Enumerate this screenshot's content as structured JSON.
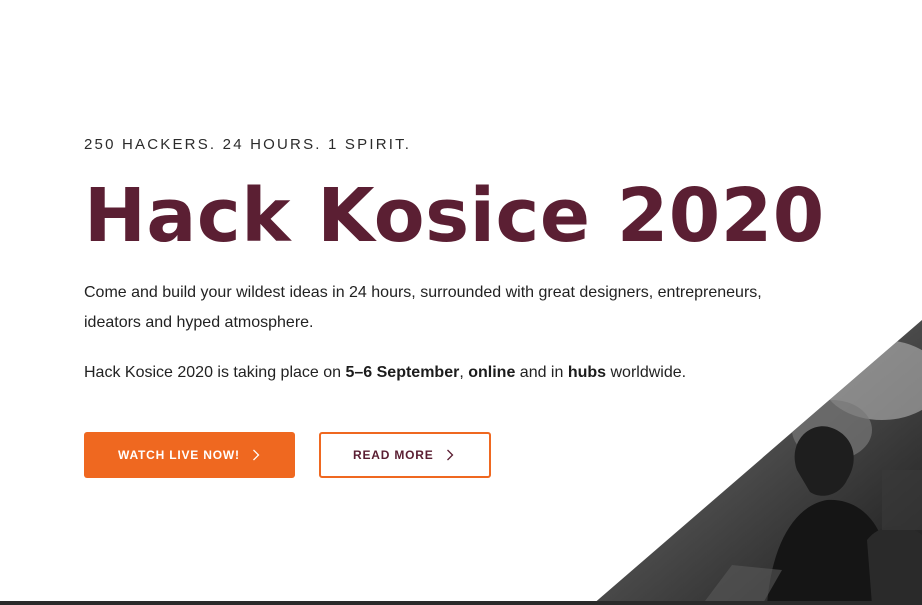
{
  "hero": {
    "tagline": "250 HACKERS. 24 HOURS. 1 SPIRIT.",
    "title": "Hack Kosice 2020",
    "intro": "Come and build your wildest ideas in 24 hours, surrounded with great designers, entrepreneurs, ideators and hyped atmosphere.",
    "dates": {
      "prefix": "Hack Kosice 2020 is taking place on ",
      "date": "5–6 September",
      "comma": ",",
      "online": "online",
      "middle": " and in ",
      "hubs": "hubs",
      "suffix": " worldwide."
    }
  },
  "buttons": {
    "watch_label": "WATCH LIVE NOW!",
    "read_label": "READ MORE"
  },
  "icons": {
    "watch_chevron": "chevron-right-icon",
    "read_chevron": "chevron-right-icon"
  },
  "colors": {
    "title": "#5b1f33",
    "accent": "#ef6820",
    "text": "#222222"
  }
}
